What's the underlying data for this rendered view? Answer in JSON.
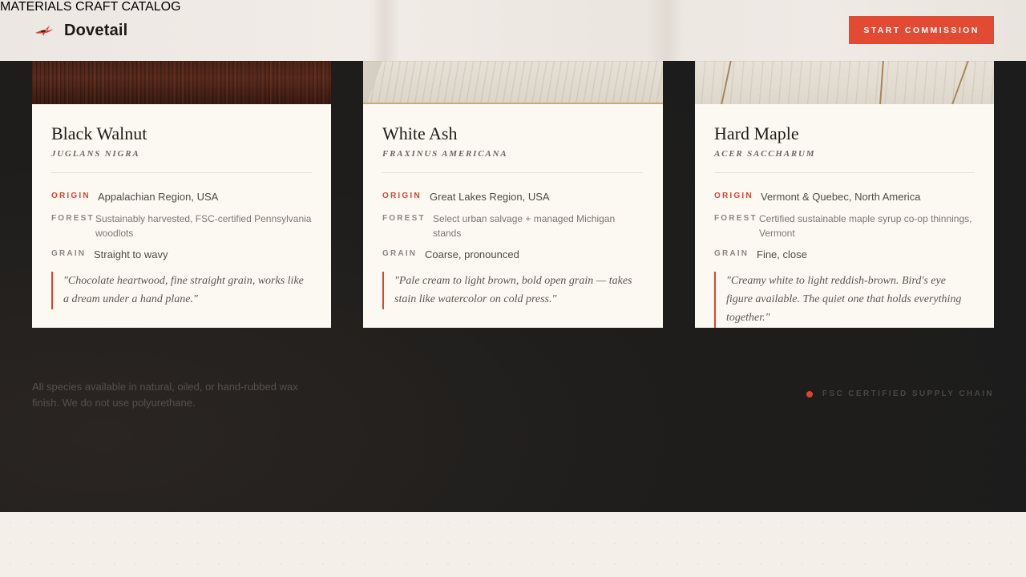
{
  "brand": {
    "name": "Dovetail",
    "logo_icon": "hummingbird-icon",
    "accent_color": "#e24a33"
  },
  "nav": {
    "items": [
      {
        "label": "MATERIALS"
      },
      {
        "label": "CRAFT"
      },
      {
        "label": "CATALOG"
      }
    ],
    "cta_label": "START COMMISSION"
  },
  "cards": [
    {
      "name": "Black Walnut",
      "latin": "JUGLANS NIGRA",
      "origin_label": "ORIGIN",
      "origin": "Appalachian Region, USA",
      "forest_label": "FOREST",
      "forest": "Sustainably harvested, FSC-certified Pennsylvania woodlots",
      "grain_label": "GRAIN",
      "grain": "Straight to wavy",
      "quote": "\"Chocolate heartwood, fine straight grain, works like a dream under a hand plane.\""
    },
    {
      "name": "White Ash",
      "latin": "FRAXINUS AMERICANA",
      "origin_label": "ORIGIN",
      "origin": "Great Lakes Region, USA",
      "forest_label": "FOREST",
      "forest": "Select urban salvage + managed Michigan stands",
      "grain_label": "GRAIN",
      "grain": "Coarse, pronounced",
      "quote": "\"Pale cream to light brown, bold open grain — takes stain like watercolor on cold press.\""
    },
    {
      "name": "Hard Maple",
      "latin": "ACER SACCHARUM",
      "origin_label": "ORIGIN",
      "origin": "Vermont & Quebec, North America",
      "forest_label": "FOREST",
      "forest": "Certified sustainable maple syrup co-op thinnings, Vermont",
      "grain_label": "GRAIN",
      "grain": "Fine, close",
      "quote": "\"Creamy white to light reddish-brown. Bird's eye figure available. The quiet one that holds everything together.\""
    }
  ],
  "footer": {
    "finish_note": "All species available in natural, oiled, or hand-rubbed wax finish. We do not use polyurethane.",
    "cert_label": "FSC CERTIFIED SUPPLY CHAIN"
  }
}
